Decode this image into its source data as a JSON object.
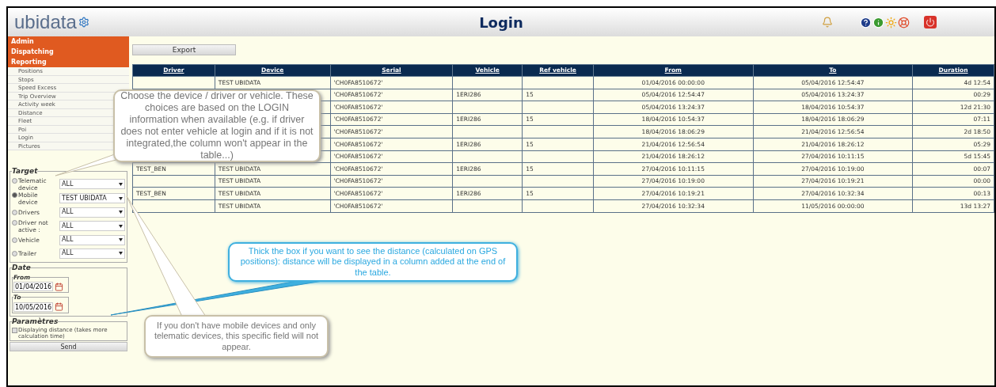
{
  "header": {
    "logo": "ubidata",
    "title": "Login"
  },
  "menu": {
    "sections": [
      {
        "label": "Admin"
      },
      {
        "label": "Dispatching"
      },
      {
        "label": "Reporting"
      }
    ],
    "items": [
      "Positions",
      "Stops",
      "Speed Excess",
      "Trip Overview",
      "Activity week",
      "Distance",
      "Fleet",
      "Poi",
      "Login",
      "Pictures"
    ]
  },
  "target": {
    "legend": "Target",
    "options": [
      {
        "label": "Telematic device",
        "selected": false,
        "value": "ALL"
      },
      {
        "label": "Mobile device",
        "selected": true,
        "value": "TEST UBIDATA"
      },
      {
        "label": "Drivers",
        "selected": false,
        "value": "ALL"
      },
      {
        "label": "Driver not active :",
        "selected": false,
        "value": "ALL"
      },
      {
        "label": "Vehicle",
        "selected": false,
        "value": "ALL"
      },
      {
        "label": "Trailer",
        "selected": false,
        "value": "ALL"
      }
    ]
  },
  "date": {
    "legend": "Date",
    "fields": [
      {
        "label": "From",
        "value": "01/04/2016"
      },
      {
        "label": "To",
        "value": "10/05/2016"
      }
    ]
  },
  "parameters": {
    "legend": "Paramètres",
    "label": "Displaying distance (takes more calculation time)",
    "checked": false
  },
  "send": "Send",
  "export": "Export",
  "table": {
    "columns": [
      "Driver",
      "Device",
      "Serial",
      "Vehicle",
      "Ref vehicle",
      "From",
      "To",
      "Duration"
    ],
    "rows": [
      [
        null,
        "TEST UBIDATA",
        "'CH0FA8510672'",
        null,
        null,
        "01/04/2016 00:00:00",
        "05/04/2016 12:54:47",
        "4d 12:54"
      ],
      [
        null,
        null,
        "'CH0FA8510672'",
        "1ERI286",
        "15",
        "05/04/2016 12:54:47",
        "05/04/2016 13:24:37",
        "00:29"
      ],
      [
        null,
        null,
        "'CH0FA8510672'",
        null,
        null,
        "05/04/2016 13:24:37",
        "18/04/2016 10:54:37",
        "12d 21:30"
      ],
      [
        null,
        null,
        "'CH0FA8510672'",
        "1ERI286",
        "15",
        "18/04/2016 10:54:37",
        "18/04/2016 18:06:29",
        "07:11"
      ],
      [
        null,
        null,
        "'CH0FA8510672'",
        null,
        null,
        "18/04/2016 18:06:29",
        "21/04/2016 12:56:54",
        "2d 18:50"
      ],
      [
        null,
        null,
        "'CH0FA8510672'",
        "1ERI286",
        "15",
        "21/04/2016 12:56:54",
        "21/04/2016 18:26:12",
        "05:29"
      ],
      [
        null,
        null,
        "'CH0FA8510672'",
        null,
        null,
        "21/04/2016 18:26:12",
        "27/04/2016 10:11:15",
        "5d 15:45"
      ],
      [
        "TEST_BEN",
        "TEST UBIDATA",
        "'CH0FA8510672'",
        "1ERI286",
        "15",
        "27/04/2016 10:11:15",
        "27/04/2016 10:19:00",
        "00:07"
      ],
      [
        null,
        "TEST UBIDATA",
        "'CH0FA8510672'",
        null,
        null,
        "27/04/2016 10:19:00",
        "27/04/2016 10:19:21",
        "00:00"
      ],
      [
        "TEST_BEN",
        "TEST UBIDATA",
        "'CH0FA8510672'",
        "1ERI286",
        "15",
        "27/04/2016 10:19:21",
        "27/04/2016 10:32:34",
        "00:13"
      ],
      [
        null,
        "TEST UBIDATA",
        "'CH0FA8510672'",
        null,
        null,
        "27/04/2016 10:32:34",
        "11/05/2016 00:00:00",
        "13d 13:27"
      ]
    ]
  },
  "callouts": [
    {
      "kind": "gray",
      "text": "Choose the device / driver or vehicle. These choices are based on the LOGIN information when available (e.g. if driver does not enter vehicle at login and if it is not integrated,the column won't appear in the table...)"
    },
    {
      "kind": "blue",
      "text": "Thick the box if you want to see the distance (calculated on GPS positions): distance will be displayed in a column added at the end of the table."
    },
    {
      "kind": "gray",
      "text": "If you don't have mobile devices and only telematic devices, this specific field will not appear."
    }
  ]
}
